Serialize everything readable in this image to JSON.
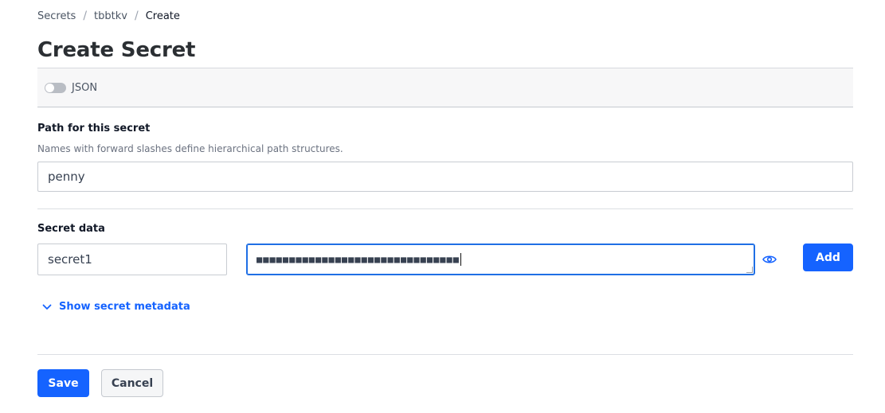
{
  "breadcrumb": {
    "items": [
      "Secrets",
      "tbbtkv"
    ],
    "current": "Create",
    "separator": "/"
  },
  "page": {
    "title": "Create Secret"
  },
  "json_toggle": {
    "label": "JSON",
    "enabled": false
  },
  "path": {
    "label": "Path for this secret",
    "help": "Names with forward slashes define hierarchical path structures.",
    "value": "penny"
  },
  "secret_data": {
    "label": "Secret data",
    "key_value": "secret1",
    "masked_value": "■■■■■■■■■■■■■■■■■■■■■■■■■■■■■■■",
    "add_label": "Add",
    "reveal_icon": "eye-icon"
  },
  "metadata": {
    "link_label": "Show secret metadata",
    "icon": "chevron-down-icon"
  },
  "actions": {
    "save_label": "Save",
    "cancel_label": "Cancel"
  },
  "colors": {
    "primary": "#1563ff",
    "focus": "#1f6fe5"
  }
}
